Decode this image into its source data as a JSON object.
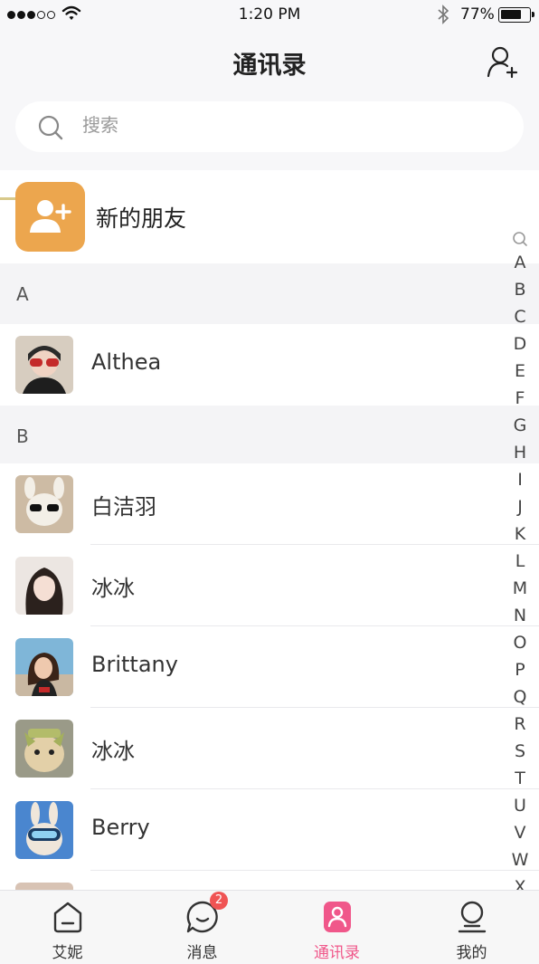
{
  "status_bar": {
    "time": "1:20 PM",
    "battery": "77%",
    "battery_level": 0.77
  },
  "header": {
    "title": "通讯录"
  },
  "search": {
    "placeholder": "搜索"
  },
  "new_friends": {
    "label": "新的朋友"
  },
  "sections": [
    {
      "letter": "A",
      "contacts": [
        {
          "name": "Althea",
          "avatar_icon": "avatar-photo"
        }
      ]
    },
    {
      "letter": "B",
      "contacts": [
        {
          "name": "白洁羽",
          "avatar_icon": "avatar-photo"
        },
        {
          "name": "冰冰",
          "avatar_icon": "avatar-photo"
        },
        {
          "name": "Brittany",
          "avatar_icon": "avatar-photo"
        },
        {
          "name": "冰冰",
          "avatar_icon": "avatar-photo"
        },
        {
          "name": "Berry",
          "avatar_icon": "avatar-photo"
        }
      ]
    }
  ],
  "index_bar": {
    "letters": [
      "A",
      "B",
      "C",
      "D",
      "E",
      "F",
      "G",
      "H",
      "I",
      "J",
      "K",
      "L",
      "M",
      "N",
      "O",
      "P",
      "Q",
      "R",
      "S",
      "T",
      "U",
      "V",
      "W",
      "X"
    ]
  },
  "tab_bar": {
    "tabs": [
      {
        "label": "艾妮",
        "icon": "home-icon"
      },
      {
        "label": "消息",
        "icon": "chat-icon",
        "badge": "2"
      },
      {
        "label": "通讯录",
        "icon": "contacts-icon",
        "active": true
      },
      {
        "label": "我的",
        "icon": "profile-icon"
      }
    ]
  },
  "colors": {
    "accent": "#f0578a",
    "new_friend_icon_bg": "#eca64e",
    "badge": "#f05454",
    "background": "#f7f7f9"
  }
}
